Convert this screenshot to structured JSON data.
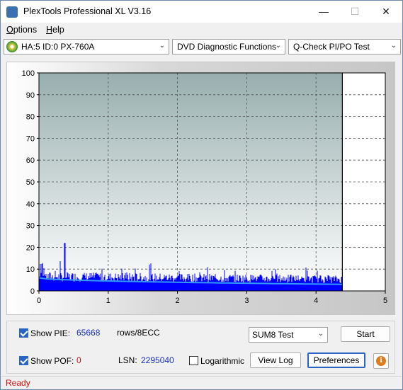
{
  "window": {
    "title": "PlexTools Professional XL V3.16"
  },
  "menu": {
    "options_label": "Options",
    "help_label": "Help"
  },
  "toolbar": {
    "drive": "HA:5 ID:0  PX-760A",
    "function": "DVD Diagnostic Functions",
    "test": "Q-Check PI/PO Test"
  },
  "chart_data": {
    "type": "bar",
    "x_range": [
      0,
      5
    ],
    "x_ticks": [
      "0",
      "1",
      "2",
      "3",
      "4",
      "5"
    ],
    "y_range": [
      0,
      100
    ],
    "y_ticks": [
      "0",
      "10",
      "20",
      "30",
      "40",
      "50",
      "60",
      "70",
      "80",
      "90",
      "100"
    ],
    "data_end_x": 4.38,
    "grid": true,
    "series": [
      {
        "type": "bar",
        "color": "#0000ff",
        "baseline": 10,
        "approx_peak": [
          0.37,
          22
        ],
        "note_shape": "noisy"
      },
      {
        "type": "line",
        "color": "#33aaff",
        "start_value": 6,
        "end_value": 3
      }
    ],
    "colors": {
      "bars": "#0000ff",
      "avg_line": "#3399ff",
      "plot_bg_top": "#98aeae",
      "plot_bg_bottom": "#ffffff"
    }
  },
  "controls": {
    "show_pie_label": "Show PIE:",
    "pie_value": "65668",
    "pie_unit": "rows/8ECC",
    "show_pof_label": "Show POF:",
    "pof_value": "0",
    "lsn_label": "LSN:",
    "lsn_value": "2295040",
    "logarithmic_label": "Logarithmic",
    "sum_select": "SUM8 Test",
    "start_label": "Start",
    "view_log_label": "View Log",
    "preferences_label": "Preferences"
  },
  "status": {
    "text": "Ready"
  }
}
